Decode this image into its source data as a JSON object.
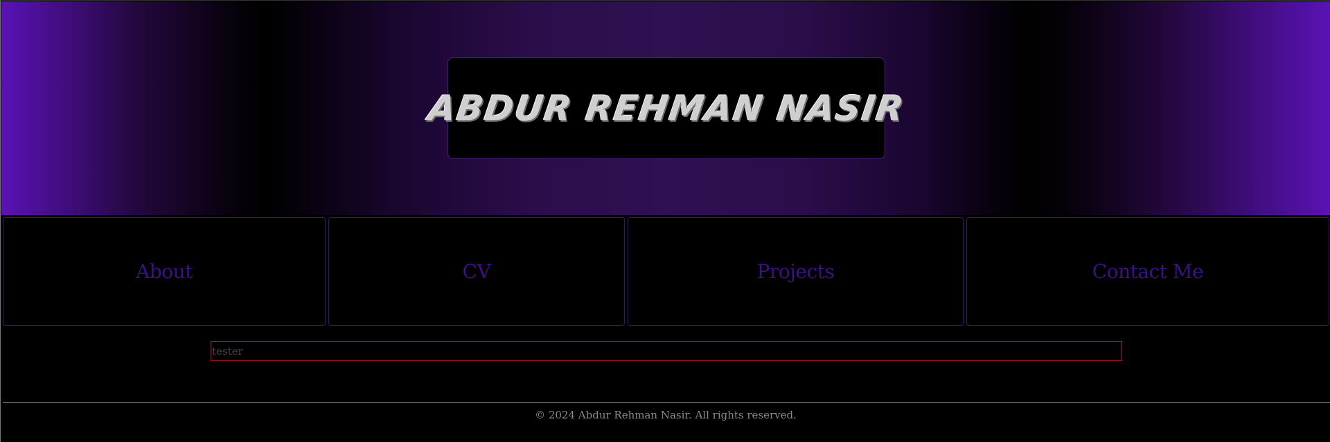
{
  "header": {
    "title": "Abdur Rehman Nasir"
  },
  "nav": {
    "items": [
      {
        "label": "About"
      },
      {
        "label": "CV"
      },
      {
        "label": "Projects"
      },
      {
        "label": "Contact Me"
      }
    ]
  },
  "search": {
    "placeholder": "tester",
    "value": ""
  },
  "footer": {
    "copyright": "© 2024 Abdur Rehman Nasir. All rights reserved."
  },
  "colors": {
    "accent_purple": "#5a12b6",
    "nav_text": "#3d1185",
    "input_border": "#b3122a"
  }
}
